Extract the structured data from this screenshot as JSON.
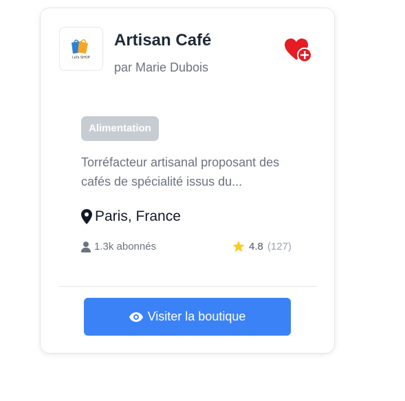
{
  "shop": {
    "logo_text": "Let's SHOP",
    "name": "Artisan Café",
    "owner": "par Marie Dubois",
    "category": "Alimentation",
    "description": "Torréfacteur artisanal proposant des cafés de spécialité issus du...",
    "location": "Paris, France",
    "followers": "1.3k abonnés",
    "rating": "4.8",
    "review_count": "(127)",
    "visit_label": "Visiter la boutique"
  },
  "icons": {
    "favorite": "heart-plus-icon",
    "location": "map-pin-icon",
    "followers": "user-icon",
    "rating": "star-icon",
    "visit": "eye-icon"
  },
  "colors": {
    "primary": "#3b82f6",
    "favorite": "#e51c23",
    "star": "#facc15",
    "badge": "#c7ccd3"
  }
}
